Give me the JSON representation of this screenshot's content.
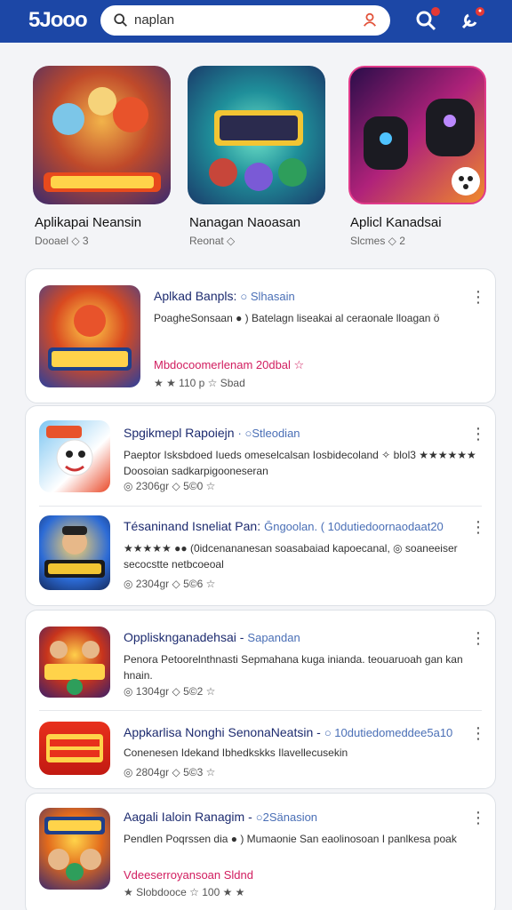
{
  "header": {
    "logo": "5Jooo",
    "search_value": "naplan"
  },
  "featured": [
    {
      "title": "Aplikapai Neansin",
      "meta": "Dooael  ◇ 3"
    },
    {
      "title": "Nanagan Naoasan",
      "meta": "Reonat  ◇"
    },
    {
      "title": "Aplicl Kanadsai",
      "meta": "Slcmes  ◇ 2"
    }
  ],
  "cards": [
    {
      "rows": [
        {
          "title": "Aplkad Banpls:",
          "sub": "○ Slhasain",
          "desc": "PoagheSonsaan ● ) Batelagn liseakai al ceraonale lloagan ö",
          "red": "Mbdocoomerlenam 20dbal ☆",
          "stats": "★ ★  110 p  ☆ Sbad"
        }
      ]
    },
    {
      "rows": [
        {
          "title": "Spgikmepl Rapoiejn",
          "sub": "· ○Stleodian",
          "desc": "Paeptor Isksbdoed  Iueds  omeselcalsan Iosbidecoland ✧ blol3 ★★★★★★ Doosoian sadkarpigooneseran",
          "stats": "◎ 2306gr  ◇ 5©0  ☆"
        },
        {
          "title": "Tésaninand Isneliat Pan:",
          "sub": "Ḡngoolan.  ( 10dutiedoornaodaat20",
          "desc": "★★★★★ ●●  (0idcenananesan soasabaiad kapoecanal, ◎ soaneeiser secocstte netbcoeoal",
          "stats": "◎ 2304gr  ◇ 5©6  ☆"
        }
      ]
    },
    {
      "rows": [
        {
          "title": "Opplisknganadehsai -",
          "sub": "Sapandan",
          "desc": "Penora Petoorelnthnasti Sepmahana kuga inianda. teouaruoah gan kan hnain.",
          "stats": "◎ 1304gr  ◇ 5©2  ☆"
        },
        {
          "title": "Appkarlisa Nonghi SenonaNeatsin -",
          "sub": "○ 10dutiedomeddee5a10",
          "desc": "Conenesen Idekand Ibhedkskks Ilavellecusekin",
          "stats": "◎ 2804gr  ◇ 5©3  ☆"
        }
      ]
    },
    {
      "rows": [
        {
          "title": "Aagali Ialoin Ranagim -",
          "sub": "○2Sänasion",
          "desc": "Pendlen Poqrssen dia ● ) Mumaonie San eaolinosoan I panlkesa poak",
          "red": "Vdeeserroyansoan Sldnd",
          "stats": "★ Slobdooce ☆ 100 ★ ★"
        }
      ]
    }
  ],
  "colors": {
    "header": "#1c47a6",
    "title": "#1d2b6f",
    "accent_red": "#d11d5f",
    "star": "#f4b400"
  }
}
